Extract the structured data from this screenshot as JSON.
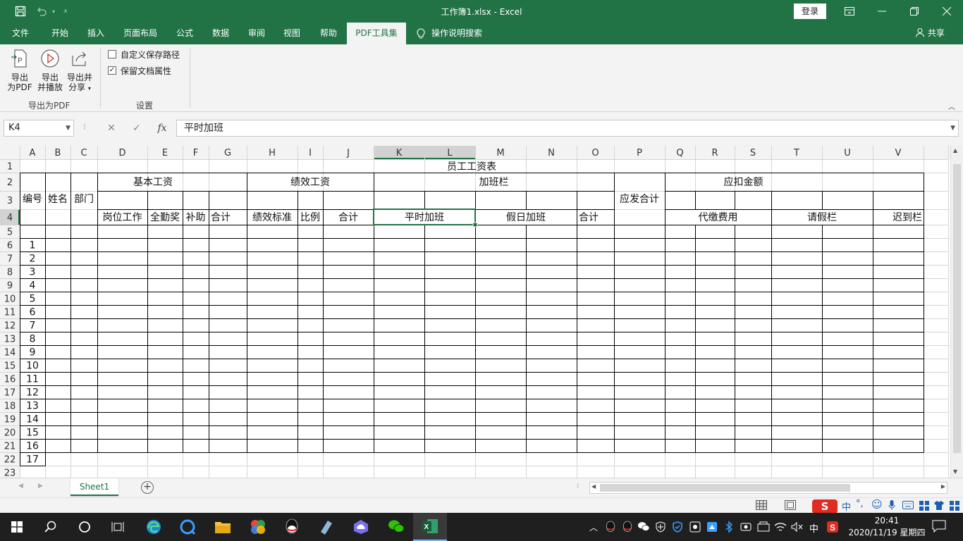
{
  "window": {
    "title": "工作簿1.xlsx  -  Excel",
    "login_label": "登录"
  },
  "menu": {
    "tabs": [
      "文件",
      "开始",
      "插入",
      "页面布局",
      "公式",
      "数据",
      "审阅",
      "视图",
      "帮助",
      "PDF工具集",
      "操作说明搜索"
    ],
    "active": "PDF工具集",
    "share_label": "共享"
  },
  "ribbon": {
    "export_pdf_l1": "导出",
    "export_pdf_l2": "为PDF",
    "export_play_l1": "导出",
    "export_play_l2": "并播放",
    "export_share_l1": "导出并",
    "export_share_l2": "分享",
    "group_export": "导出为PDF",
    "custom_path": "自定义保存路径",
    "custom_path_checked": false,
    "keep_props": "保留文档属性",
    "keep_props_checked": true,
    "group_settings": "设置"
  },
  "formula_bar": {
    "name_box": "K4",
    "formula": "平时加班"
  },
  "grid": {
    "columns": [
      "A",
      "B",
      "C",
      "D",
      "E",
      "F",
      "G",
      "H",
      "I",
      "J",
      "K",
      "L",
      "M",
      "N",
      "O",
      "P",
      "Q",
      "R",
      "S",
      "T",
      "U",
      "V"
    ],
    "rows": [
      "1",
      "2",
      "3",
      "4",
      "5",
      "6",
      "7",
      "8",
      "9",
      "10",
      "11",
      "12",
      "13",
      "14",
      "15",
      "16",
      "17",
      "18",
      "19",
      "20",
      "21",
      "22",
      "23"
    ],
    "selected_cell": "K4",
    "cells": {
      "title": "员工工资表",
      "id": "编号",
      "name": "姓名",
      "dept": "部门",
      "basic": "基本工资",
      "perf": "绩效工资",
      "ot": "加班栏",
      "gross": "应发合计",
      "deduct": "应扣金额",
      "post": "岗位工作",
      "attendance": "全勤奖",
      "subsidy": "补助",
      "total1": "合计",
      "perf_std": "绩效标准",
      "ratio": "比例",
      "total2": "合计",
      "ot_normal": "平时加班",
      "ot_holiday": "假日加班",
      "total3": "合计",
      "withheld": "代缴费用",
      "leave": "请假栏",
      "late": "迟到栏"
    },
    "numbers": [
      "1",
      "2",
      "3",
      "4",
      "5",
      "6",
      "7",
      "8",
      "9",
      "10",
      "11",
      "12",
      "13",
      "14",
      "15",
      "16",
      "17"
    ]
  },
  "sheets": {
    "tabs": [
      "Sheet1"
    ],
    "active": "Sheet1"
  },
  "taskbar": {
    "ime": "中",
    "time": "20:41",
    "date": "2020/11/19 星期四"
  },
  "colors": {
    "excel_green": "#217346",
    "grid_line": "#d4d4d4",
    "border_line": "#000000"
  }
}
